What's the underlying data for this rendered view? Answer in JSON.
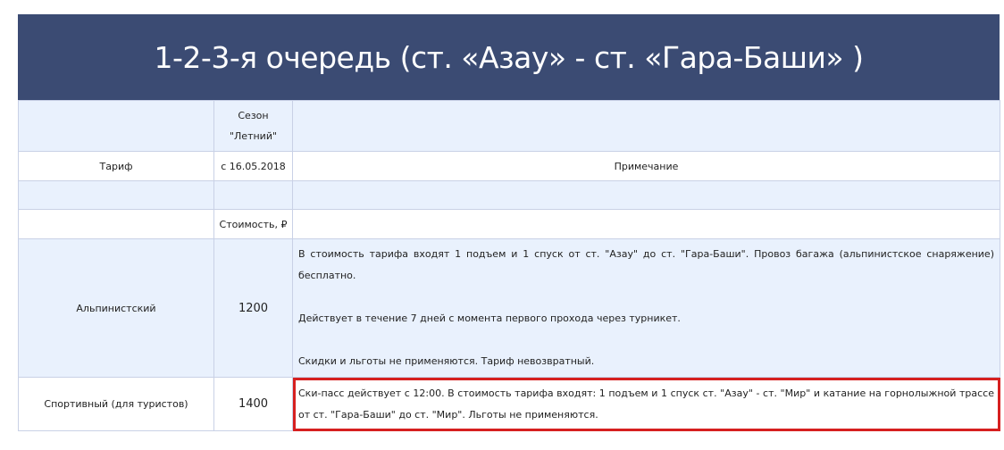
{
  "title": "1-2-3-я очередь (ст. «Азау» - ст. «Гара-Баши» )",
  "header": {
    "season_line1": "Сезон",
    "season_line2": "\"Летний\"",
    "tariff_label": "Тариф",
    "date_label": "с 16.05.2018",
    "note_label": "Примечание",
    "cost_label": "Стоимость, ₽"
  },
  "rows": [
    {
      "name": "Альпинистский",
      "price": "1200",
      "notes": [
        "В стоимость тарифа входят 1 подъем и 1 спуск  от ст. \"Азау\" до ст. \"Гара-Баши\". Провоз багажа (альпинистское снаряжение) бесплатно.",
        "Действует в течение 7 дней с момента первого прохода через турникет.",
        "Скидки и льготы не применяются. Тариф невозвратный."
      ]
    },
    {
      "name": "Спортивный (для туристов)",
      "price": "1400",
      "notes": [
        "Ски-пасс действует с 12:00. В стоимость тарифа входят: 1 подъем и 1 спуск ст. \"Азау\" - ст. \"Мир\" и катание на горнолыжной трассе от ст. \"Гара-Баши\" до ст. \"Мир\". Льготы не применяются."
      ]
    }
  ],
  "colors": {
    "title_bg": "#3b4b73",
    "row_blue": "#e9f1fd",
    "highlight_border": "#d62020"
  }
}
